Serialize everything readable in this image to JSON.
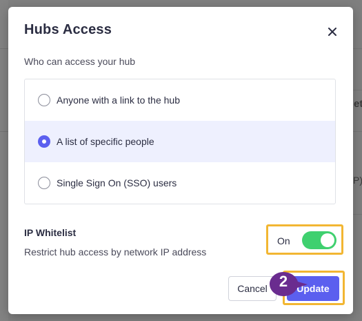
{
  "modal": {
    "title": "Hubs Access",
    "subtitle": "Who can access your hub",
    "access_options": [
      {
        "label": "Anyone with a link to the hub",
        "selected": false
      },
      {
        "label": "A list of specific people",
        "selected": true
      },
      {
        "label": "Single Sign On (SSO) users",
        "selected": false
      }
    ],
    "ip_whitelist": {
      "title": "IP Whitelist",
      "description": "Restrict hub access by network IP address",
      "toggle_label": "On",
      "enabled": true
    },
    "buttons": {
      "cancel": "Cancel",
      "update": "Update"
    }
  },
  "annotation": {
    "step_number": "2",
    "highlight_color": "#f2b632",
    "marker_color": "#6a2c8f"
  },
  "icons": {
    "close": "close-icon"
  },
  "colors": {
    "accent": "#5b5fef",
    "toggle_on": "#3fd06f",
    "selected_row_bg": "#eef0fe"
  },
  "background_page": {
    "partial_text_1": "et",
    "partial_text_2": "P)"
  }
}
